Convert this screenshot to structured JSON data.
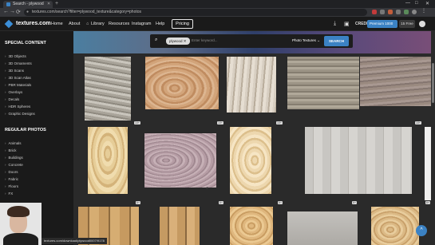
{
  "browser": {
    "tab_title": "Search - plywood",
    "url": "textures.com/search?filter=plywood_texture&category=photos",
    "new_tab": "+",
    "win_min": "—",
    "win_max": "□",
    "win_close": "✕",
    "back": "←",
    "forward": "→",
    "reload": "⟳"
  },
  "site": {
    "logo": "textures.com",
    "nav": [
      "Home",
      "About",
      "Library",
      "Resources",
      "Instagram",
      "Help"
    ],
    "pricing": "Pricing",
    "credits": "CREDITS",
    "premium": "Premium 1000",
    "free": "15 Free"
  },
  "sidebar": {
    "special_heading": "SPECIAL CONTENT",
    "special_items": [
      "3D Objects",
      "3D Ornaments",
      "3D Scans",
      "3D Scan Atlas",
      "PBR Materials",
      "Overlays",
      "Decals",
      "HDR Spheres",
      "Graphic Designs"
    ],
    "regular_heading": "REGULAR PHOTOS",
    "regular_items": [
      "Animals",
      "Brick",
      "Buildings",
      "Concrete",
      "Doors",
      "Fabric",
      "Floors",
      "FX"
    ]
  },
  "search": {
    "chip": "plywood",
    "placeholder": "Enter keyword...",
    "category": "Photo Textures",
    "button": "SEARCH"
  },
  "tiles": {
    "badge": "10+",
    "badge_b": "6+"
  },
  "status_url": "textures.com/download/plywood0007/9178",
  "colors": {
    "accent": "#3b82c4",
    "bg": "#1a1a1a"
  }
}
